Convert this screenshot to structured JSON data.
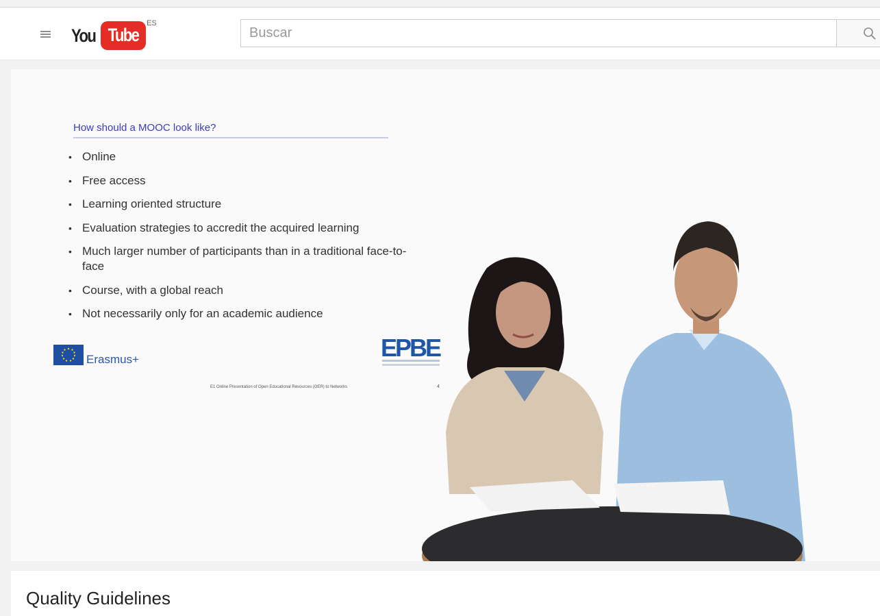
{
  "header": {
    "logo": {
      "you": "You",
      "tube": "Tube",
      "country": "ES"
    },
    "search": {
      "placeholder": "Buscar",
      "value": ""
    },
    "icons": {
      "menu": "hamburger-menu-icon",
      "search": "search-icon"
    }
  },
  "slide": {
    "title": "How should a MOOC look like?",
    "bullets": [
      "Online",
      "Free access",
      "Learning oriented structure",
      "Evaluation strategies to accredit the acquired learning",
      "Much larger number of participants than in a traditional face-to-face",
      "Course, with a global reach",
      "Not necessarily only for an academic audience"
    ],
    "erasmus_label": "Erasmus+",
    "epbe_logo": "EPBE",
    "footer_text": "E1 Online Presentation of Open Educational Resources (OER) to Networks",
    "page_number": "4"
  },
  "video": {
    "title": "Quality Guidelines"
  },
  "colors": {
    "brand_red": "#e52d27",
    "slide_title": "#3b3bbf",
    "erasmus_blue": "#2a58a6"
  }
}
